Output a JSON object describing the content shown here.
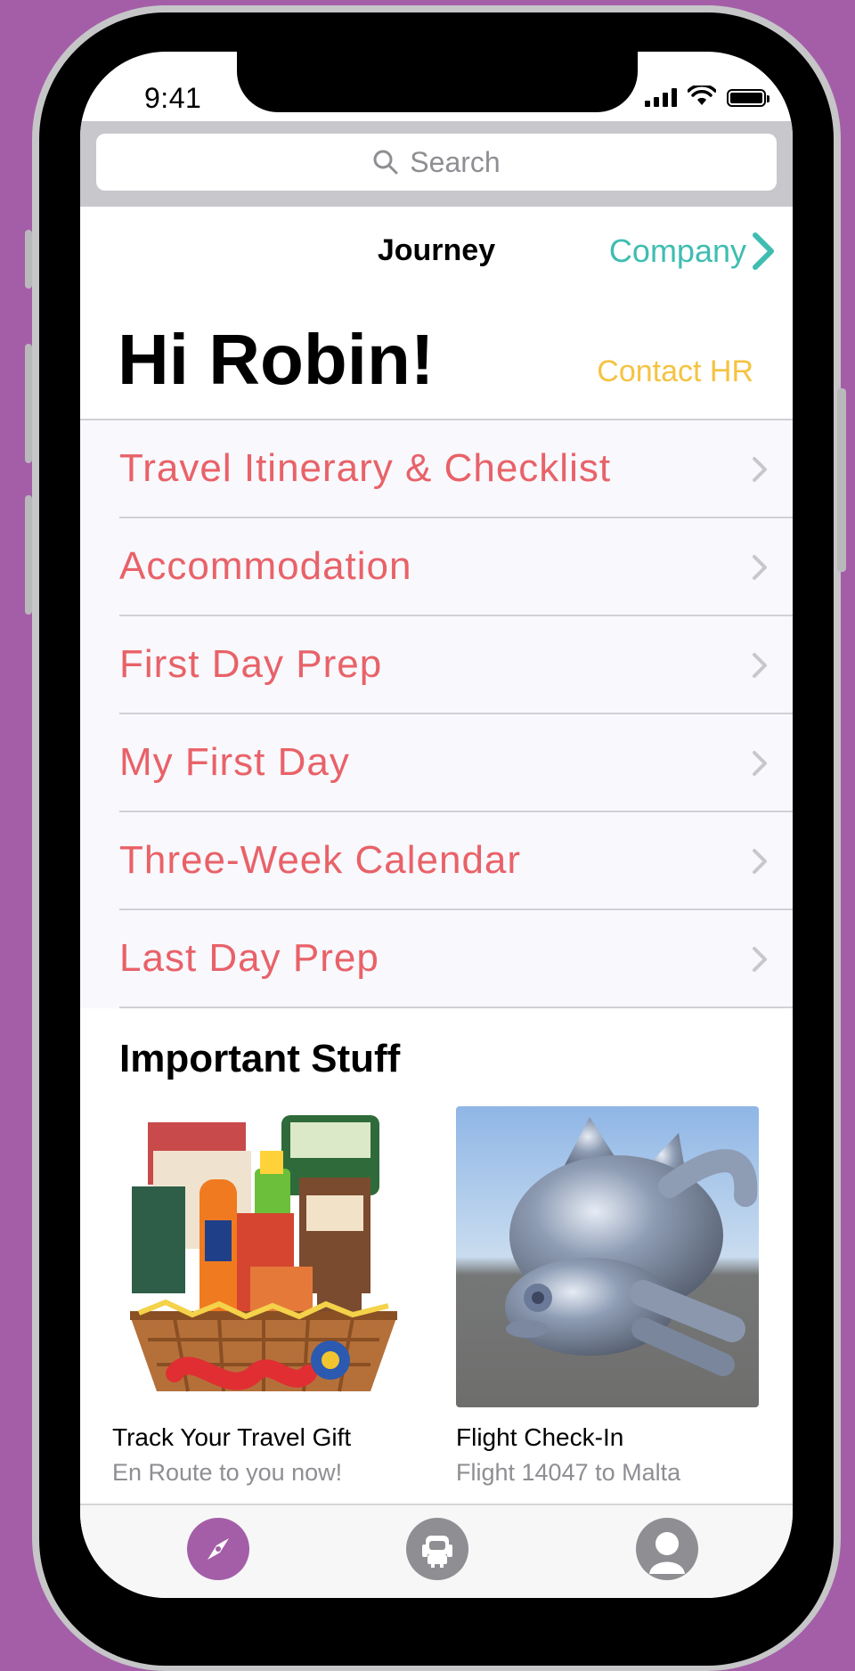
{
  "status_bar": {
    "time": "9:41"
  },
  "search": {
    "placeholder": "Search"
  },
  "nav": {
    "title": "Journey",
    "right_link": "Company"
  },
  "header": {
    "greeting": "Hi Robin!",
    "contact": "Contact HR"
  },
  "menu": {
    "items": [
      {
        "label": "Travel Itinerary & Checklist"
      },
      {
        "label": "Accommodation"
      },
      {
        "label": "First Day Prep"
      },
      {
        "label": "My First Day"
      },
      {
        "label": "Three-Week Calendar"
      },
      {
        "label": "Last Day Prep"
      }
    ]
  },
  "important": {
    "title": "Important Stuff",
    "cards": [
      {
        "title": "Track Your Travel Gift",
        "subtitle": "En Route to you now!",
        "image": "gift-basket-image"
      },
      {
        "title": "Flight Check-In",
        "subtitle": "Flight 14047 to Malta",
        "image": "chrome-cat-3d-render"
      }
    ]
  },
  "tabs": [
    {
      "icon": "compass-icon",
      "active": true
    },
    {
      "icon": "robot-icon",
      "active": false
    },
    {
      "icon": "profile-icon",
      "active": false
    }
  ],
  "colors": {
    "background": "#a45ea8",
    "menu_text": "#e86268",
    "accent_teal": "#3fbdb1",
    "contact_yellow": "#f5c341",
    "tab_active": "#a45ea8",
    "tab_inactive": "#8e8e93"
  }
}
